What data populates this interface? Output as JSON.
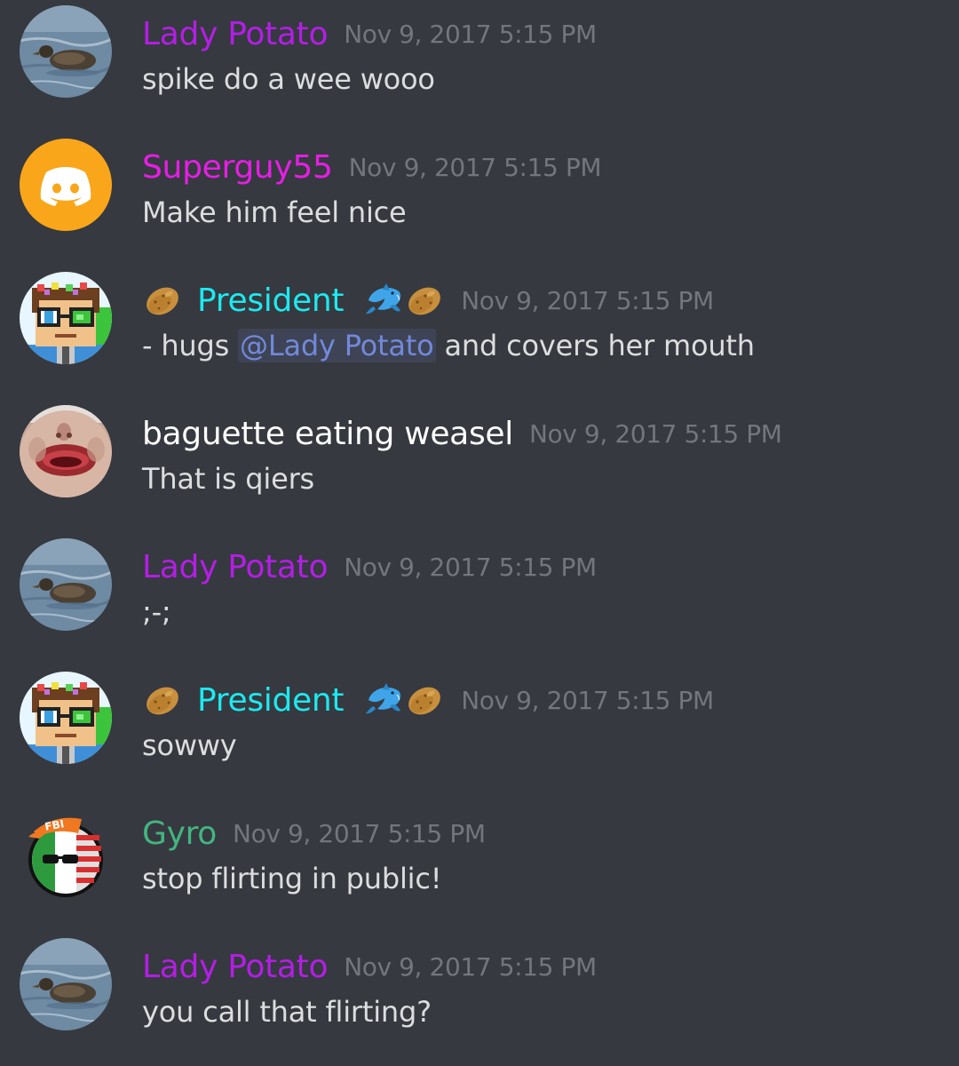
{
  "colors": {
    "background": "#36393f",
    "lady_potato": "#b41ee6",
    "superguy": "#e61ee6",
    "president": "#1de9f0",
    "baguette": "#ffffff",
    "gyro": "#43b581",
    "timestamp": "#72767d",
    "text": "#dcddde",
    "mention": "#7289da"
  },
  "messages": [
    {
      "author": "Lady Potato",
      "timestamp": "Nov 9, 2017 5:15 PM",
      "text": "spike do a wee wooo",
      "avatar": "duck-avatar"
    },
    {
      "author": "Superguy55",
      "timestamp": "Nov 9, 2017 5:15 PM",
      "text": "Make him feel nice",
      "avatar": "discord-default-avatar"
    },
    {
      "author": "President",
      "timestamp": "Nov 9, 2017 5:15 PM",
      "text_before": "- hugs ",
      "mention": "@Lady Potato",
      "text_after": " and covers her mouth",
      "avatar": "pixel-character-avatar",
      "name_icons": [
        "potato-icon",
        "dolphin-icon",
        "potato-icon"
      ]
    },
    {
      "author": "baguette eating weasel",
      "timestamp": "Nov 9, 2017 5:15 PM",
      "text": "That is qiers",
      "avatar": "face-avatar"
    },
    {
      "author": "Lady Potato",
      "timestamp": "Nov 9, 2017 5:15 PM",
      "text": ";-;",
      "avatar": "duck-avatar"
    },
    {
      "author": "President",
      "timestamp": "Nov 9, 2017 5:15 PM",
      "text": "sowwy",
      "avatar": "pixel-character-avatar",
      "name_icons": [
        "potato-icon",
        "dolphin-icon",
        "potato-icon"
      ]
    },
    {
      "author": "Gyro",
      "timestamp": "Nov 9, 2017 5:15 PM",
      "text": "stop flirting in public!",
      "avatar": "countryball-avatar",
      "avatar_cap_text": "FBI"
    },
    {
      "author": "Lady Potato",
      "timestamp": "Nov 9, 2017 5:15 PM",
      "text": "you call that flirting?",
      "avatar": "duck-avatar"
    }
  ]
}
